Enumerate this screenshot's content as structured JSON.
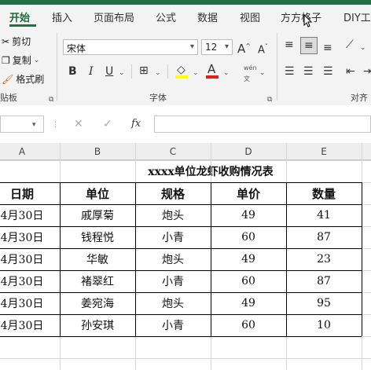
{
  "ribbon_tabs": [
    "开始",
    "插入",
    "页面布局",
    "公式",
    "数据",
    "视图",
    "方方格子",
    "DIY工"
  ],
  "clipboard": {
    "cut": "剪切",
    "copy": "复制",
    "format_painter": "格式刷",
    "group_label": "贴板"
  },
  "font": {
    "name": "宋体",
    "size": "12",
    "grow": "A",
    "shrink": "A",
    "bold": "B",
    "italic": "I",
    "underline": "U",
    "group_label": "字体"
  },
  "align": {
    "group_label": "对齐"
  },
  "formula_bar": {
    "cancel": "✕",
    "confirm": "✓",
    "fx": "fx",
    "value": ""
  },
  "columns": [
    "A",
    "B",
    "C",
    "D",
    "E"
  ],
  "sheet": {
    "title": "xxxx单位龙虾收购情况表",
    "headers": [
      "日期",
      "单位",
      "规格",
      "单价",
      "数量"
    ],
    "rows": [
      [
        "4月30日",
        "戚厚菊",
        "炮头",
        "49",
        "41"
      ],
      [
        "4月30日",
        "钱程悦",
        "小青",
        "60",
        "87"
      ],
      [
        "4月30日",
        "华敏",
        "炮头",
        "49",
        "23"
      ],
      [
        "4月30日",
        "褚翠红",
        "小青",
        "60",
        "87"
      ],
      [
        "4月30日",
        "姜宛海",
        "炮头",
        "49",
        "95"
      ],
      [
        "4月30日",
        "孙安琪",
        "小青",
        "60",
        "10"
      ]
    ]
  },
  "colors": {
    "accent": "#217346",
    "font_color": "#e0201b",
    "highlight": "#ffff00"
  }
}
